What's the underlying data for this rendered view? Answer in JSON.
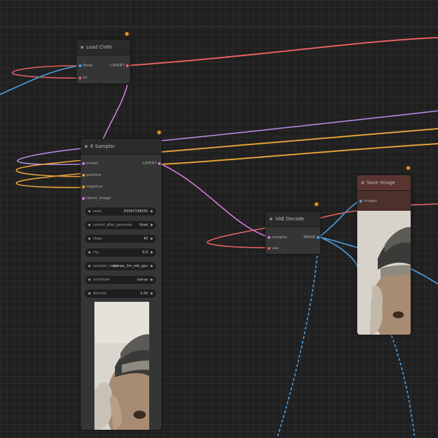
{
  "colors": {
    "canvas_bg": "#202020",
    "node_bg": "#353535",
    "link_red": "#e86262",
    "link_pink": "#d97ce0",
    "link_purple": "#b58be2",
    "link_orange": "#e8a23a",
    "link_blue": "#4fa3e6",
    "badge": "#e39a2b",
    "image_node_title_bg": "#5a3530"
  },
  "nodes": {
    "load_node": {
      "title": "Load Cloth",
      "inputs": [
        "Node",
        "ttr"
      ],
      "output": "LATENT"
    },
    "sampler_node": {
      "title": "K Sampler",
      "inputs": [
        "model",
        "positive",
        "negative",
        "latent_image"
      ],
      "output": "LATENT",
      "widgets": [
        {
          "label": "seed",
          "value": "83082338930"
        },
        {
          "label": "control_after_generate",
          "value": "fixed"
        },
        {
          "label": "steps",
          "value": "40"
        },
        {
          "label": "cfg",
          "value": "8.0"
        },
        {
          "label": "sampler_name",
          "value": "dpmpp_2m_sde_gpu"
        },
        {
          "label": "scheduler",
          "value": "karras"
        },
        {
          "label": "denoise",
          "value": "1.00"
        }
      ]
    },
    "decode_node": {
      "title": "VAE Decode",
      "inputs": [
        "samples",
        "vae"
      ],
      "output": "IMAGE"
    },
    "image_node": {
      "title": "Save Image",
      "inputs": [
        "images"
      ]
    }
  }
}
